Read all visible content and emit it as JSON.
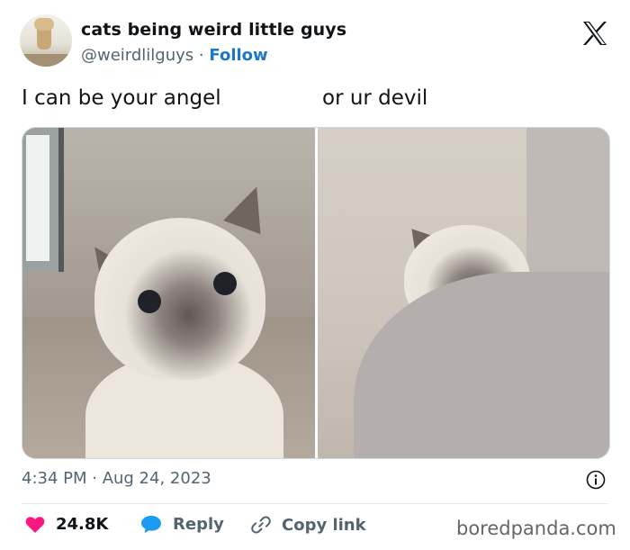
{
  "account": {
    "display_name": "cats being weird little guys",
    "handle": "@weirdlilguys",
    "separator": "·",
    "follow_label": "Follow"
  },
  "tweet": {
    "caption_left": "I can be your angel",
    "caption_right": "or ur devil",
    "timestamp": "4:34 PM · Aug 24, 2023"
  },
  "actions": {
    "likes": "24.8K",
    "reply_label": "Reply",
    "copy_link_label": "Copy link"
  },
  "watermark": "boredpanda.com",
  "colors": {
    "like": "#f91880",
    "reply": "#1d9bf0",
    "follow": "#1d77c9",
    "muted": "#536471"
  },
  "icons": [
    "x-logo-icon",
    "info-icon",
    "heart-icon",
    "speech-bubble-icon",
    "link-icon"
  ]
}
